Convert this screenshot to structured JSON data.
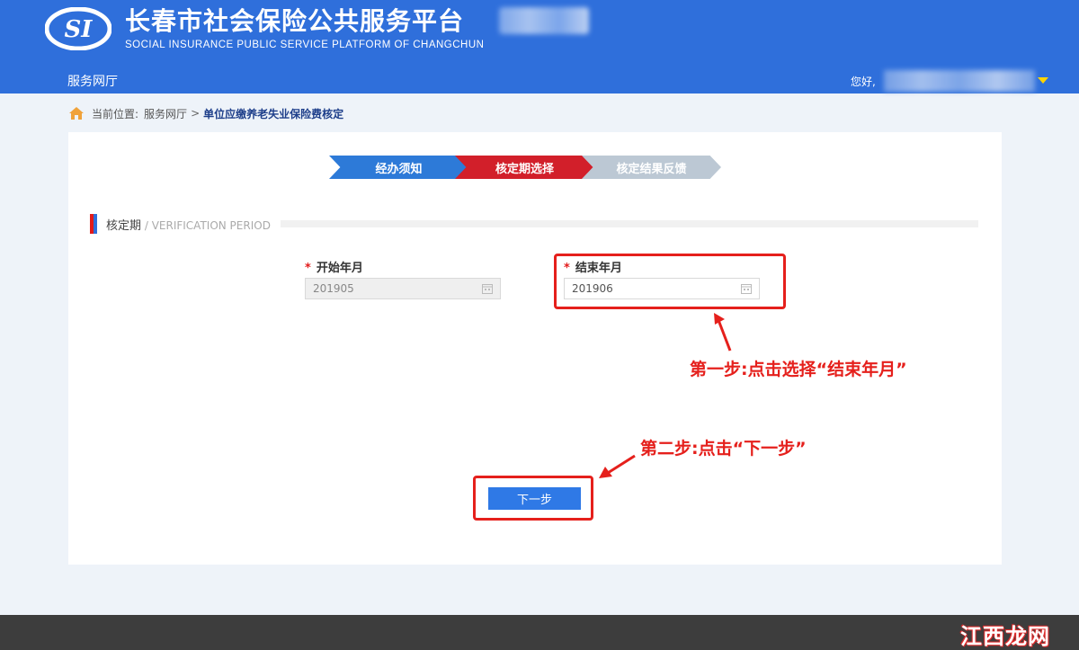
{
  "header": {
    "title_cn": "长春市社会保险公共服务平台",
    "title_en": "SOCIAL INSURANCE PUBLIC SERVICE PLATFORM OF CHANGCHUN",
    "logo_text": "SI",
    "nav_label": "服务网厅",
    "greeting": "您好,"
  },
  "breadcrumb": {
    "prefix": "当前位置:",
    "parent": "服务网厅",
    "separator": ">",
    "current": "单位应缴养老失业保险费核定"
  },
  "steps": [
    {
      "label": "经办须知",
      "state": "done",
      "color": "#2d7ad8"
    },
    {
      "label": "核定期选择",
      "state": "active",
      "color": "#d21f2a"
    },
    {
      "label": "核定结果反馈",
      "state": "pending",
      "color": "#bcc8d4"
    }
  ],
  "section": {
    "title": "核定期",
    "subtitle": " / VERIFICATION PERIOD"
  },
  "form": {
    "required_mark": "*",
    "start_label": "开始年月",
    "start_value": "201905",
    "end_label": "结束年月",
    "end_value": "201906",
    "next_button": "下一步"
  },
  "annotations": {
    "step1": "第一步:点击选择“结束年月”",
    "step2": "第二步:点击“下一步”",
    "color": "#e5201c"
  },
  "watermark": "江西龙网",
  "icons": [
    "si-logo-icon",
    "home-icon",
    "calendar-icon",
    "caret-down-icon",
    "arrow-icon"
  ]
}
